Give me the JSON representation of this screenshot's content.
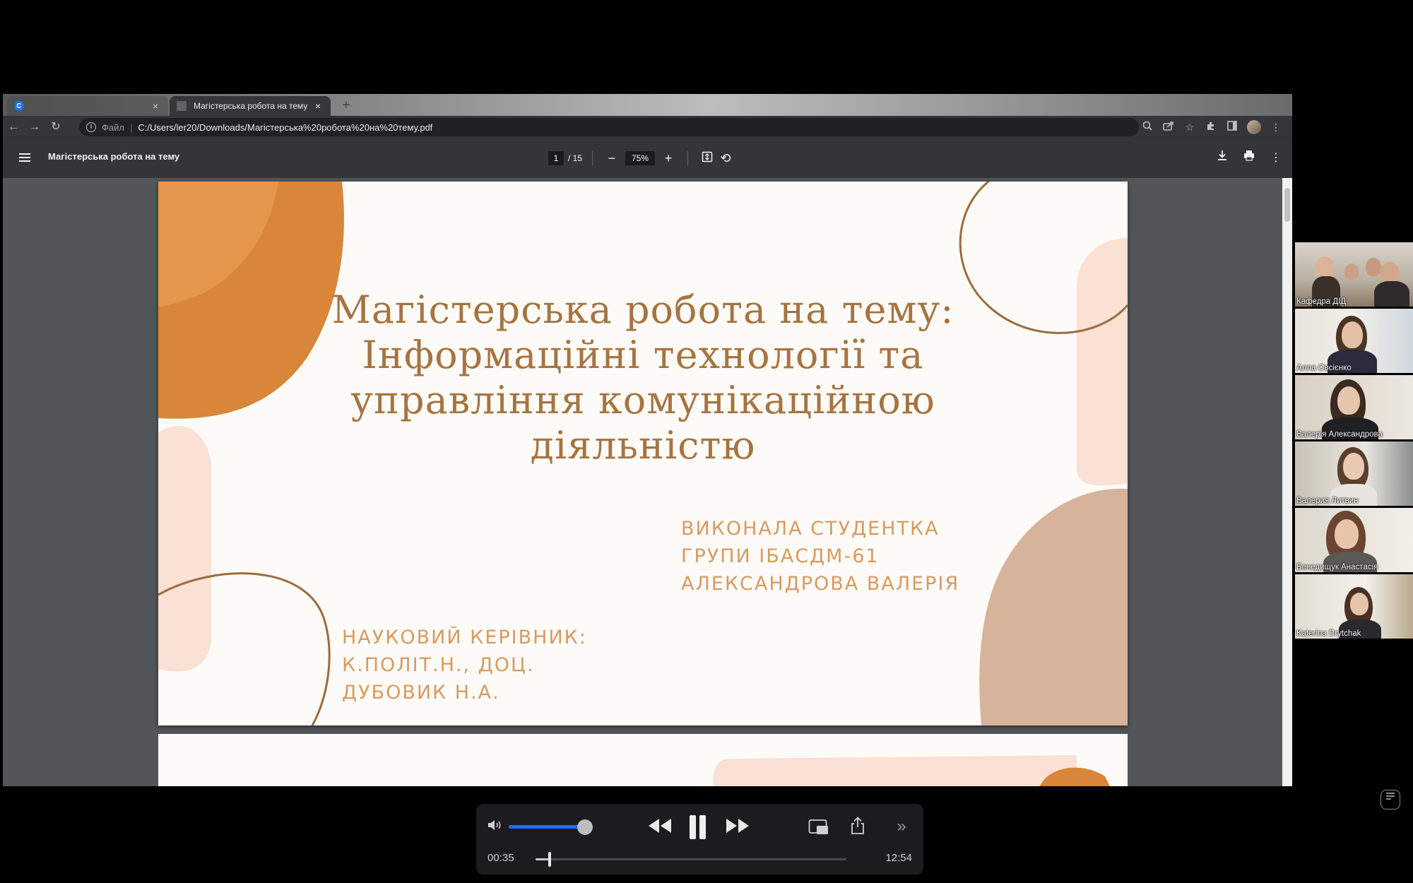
{
  "browser": {
    "tabs": [
      {
        "label": "",
        "favicon_letter": "C",
        "active": false
      },
      {
        "label": "Магістерська робота на тему",
        "active": true
      }
    ],
    "new_tab_label": "+",
    "address": {
      "scheme_label": "Файл",
      "url": "C:/Users/ler20/Downloads/Магістерська%20робота%20на%20тему.pdf"
    },
    "icons": [
      "back-icon",
      "forward-icon",
      "reload-icon",
      "info-icon",
      "zoom-icon",
      "share-icon",
      "star-icon",
      "extensions-icon",
      "sidepanel-icon",
      "menu-icon"
    ]
  },
  "pdf": {
    "title": "Магістерська робота на тему",
    "current_page": "1",
    "total_pages": "/ 15",
    "zoom": "75%",
    "slide": {
      "title_lines": [
        "Магістерська робота на тему:",
        "Інформаційні технології та",
        "управління комунікаційною",
        "діяльністю"
      ],
      "student_lines": [
        "ВИКОНАЛА СТУДЕНТКА",
        "ГРУПИ ІБАСДМ-61",
        "АЛЕКСАНДРОВА ВАЛЕРІЯ"
      ],
      "supervisor_lines": [
        "НАУКОВИЙ КЕРІВНИК:",
        "К.ПОЛІТ.Н., ДОЦ.",
        "ДУБОВИК Н.А."
      ],
      "colors": {
        "title": "#a67441",
        "caps": "#d89a60",
        "orange": "#d9853a",
        "pink": "#fbe0d4",
        "tan": "#d7b39c",
        "line": "#9b6c3f"
      }
    }
  },
  "participants": [
    {
      "name": "Кафедра ДІД"
    },
    {
      "name": "Алла Овсієнко"
    },
    {
      "name": "Валерія Александрова"
    },
    {
      "name": "Валерия Литвин"
    },
    {
      "name": "Бенедищук Анастасія"
    },
    {
      "name": "Katerina Drytchak"
    }
  ],
  "player": {
    "current_time": "00:35",
    "total_time": "12:54",
    "progress": 0.045,
    "volume": 0.78
  }
}
